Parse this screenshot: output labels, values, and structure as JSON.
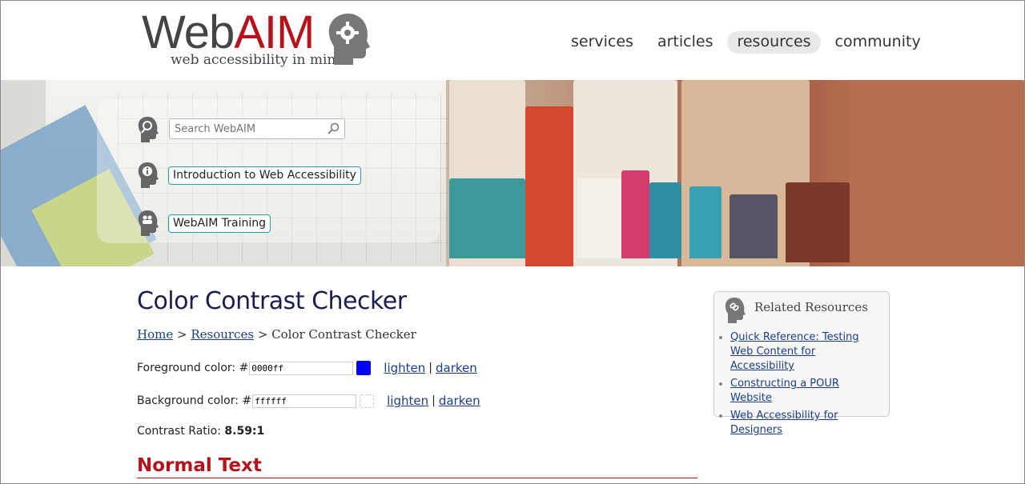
{
  "logo": {
    "word_web": "Web",
    "word_aim": "AIM",
    "tagline": "web accessibility in mind"
  },
  "nav": [
    {
      "label": "services",
      "active": false
    },
    {
      "label": "articles",
      "active": false
    },
    {
      "label": "resources",
      "active": true
    },
    {
      "label": "community",
      "active": false
    }
  ],
  "banner": {
    "search_placeholder": "Search WebAIM",
    "links": [
      "Introduction to Web Accessibility",
      "WebAIM Training"
    ]
  },
  "main": {
    "title": "Color Contrast Checker",
    "breadcrumb": {
      "home": "Home",
      "sep1": " > ",
      "resources": "Resources",
      "sep2": " > ",
      "current": "Color Contrast Checker"
    },
    "foreground": {
      "label": "Foreground color: #",
      "value": "0000ff",
      "color": "#0000ff",
      "lighten": "lighten",
      "sep": "|",
      "darken": "darken"
    },
    "background": {
      "label": "Background color: #",
      "value": "ffffff",
      "color": "#ffffff",
      "lighten": "lighten",
      "sep": "|",
      "darken": "darken"
    },
    "ratio_label": "Contrast Ratio: ",
    "ratio_value": "8.59:1",
    "section_title": "Normal Text"
  },
  "sidebar": {
    "title": "Related Resources",
    "links": [
      "Quick Reference: Testing Web Content for Accessibility",
      "Constructing a POUR Website",
      "Web Accessibility for Designers"
    ]
  },
  "colors": {
    "brand_red": "#b5121b",
    "link_blue": "#1a3e8c",
    "title_navy": "#1c1c4e",
    "teal_border": "#2a9bb0"
  }
}
